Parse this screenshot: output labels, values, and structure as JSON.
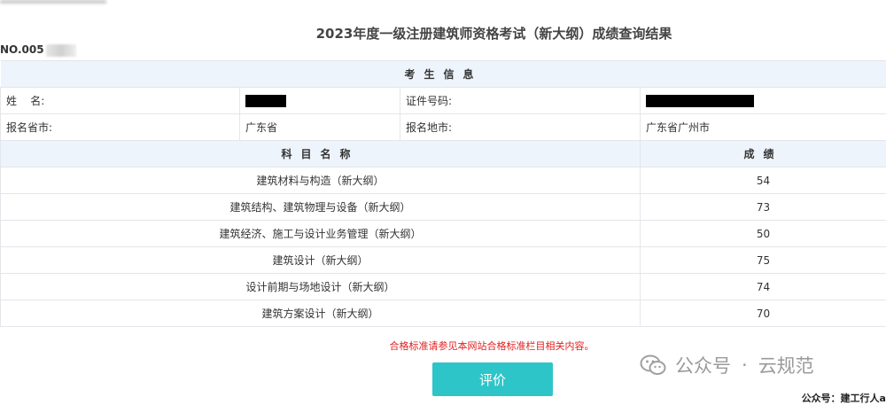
{
  "page": {
    "title": "2023年度一级注册建筑师资格考试（新大纲）成绩查询结果",
    "cert_no": "NO.005"
  },
  "table": {
    "section_examinee": "考生信息",
    "name_label": "姓    名:",
    "id_label": "证件号码:",
    "province_label": "报名省市:",
    "province_value": "广东省",
    "city_label": "报名地市:",
    "city_value": "广东省广州市",
    "subject_header": "科目名称",
    "score_header": "成绩",
    "rows": [
      {
        "subject": "建筑材料与构造（新大纲）",
        "score": "54"
      },
      {
        "subject": "建筑结构、建筑物理与设备（新大纲）",
        "score": "73"
      },
      {
        "subject": "建筑经济、施工与设计业务管理（新大纲）",
        "score": "50"
      },
      {
        "subject": "建筑设计（新大纲）",
        "score": "75"
      },
      {
        "subject": "设计前期与场地设计（新大纲）",
        "score": "74"
      },
      {
        "subject": "建筑方案设计（新大纲）",
        "score": "70"
      }
    ]
  },
  "note": "合格标准请参见本网站合格标准栏目相关内容。",
  "actions": {
    "evaluate_label": "评价"
  },
  "watermark": {
    "icon": "wechat-icon",
    "left": "公众号",
    "sep": "·",
    "right": "云规范"
  },
  "footer": {
    "account": "公众号：建工行人a"
  }
}
